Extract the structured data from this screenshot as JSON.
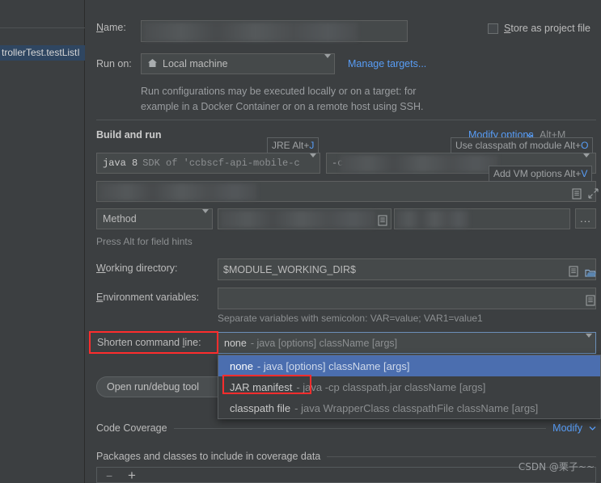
{
  "window": {
    "background": "#3c3f41",
    "accent_blue": "#589df6",
    "selection_blue": "#4b6eaf",
    "annotation_red": "#ff2d2d"
  },
  "sidebar": {
    "selected_item": "trollerTest.testListI"
  },
  "form": {
    "name_label": "Name:",
    "name_value": "",
    "store_as_project_file_label": "Store as project file",
    "store_as_project_file_checked": false,
    "run_on_label": "Run on:",
    "run_on_value": "Local machine",
    "run_on_icon": "home-icon",
    "manage_targets_link": "Manage targets...",
    "description_line1": "Run configurations may be executed locally or on a target: for",
    "description_line2": "example in a Docker Container or on a remote host using SSH.",
    "build_and_run_title": "Build and run",
    "modify_options_link": "Modify options",
    "modify_options_shortcut": "Alt+M",
    "jdk_value": "java 8",
    "jdk_suffix": "SDK of 'ccbscf-api-mobile-c",
    "vm_options_value": "-c",
    "method_label": "Method",
    "press_alt_hint": "Press Alt for field hints",
    "working_directory_label": "Working directory:",
    "working_directory_value": "$MODULE_WORKING_DIR$",
    "environment_variables_label": "Environment variables:",
    "environment_variables_value": "",
    "environment_hint": "Separate variables with semicolon: VAR=value; VAR1=value1",
    "shorten_command_line_label": "Shorten command line:",
    "shorten_command_line_value_strong": "none",
    "shorten_command_line_value_dim": "- java [options] className [args]",
    "open_run_debug_button": "Open run/debug tool",
    "code_coverage_title": "Code Coverage",
    "code_coverage_modify_link": "Modify",
    "packages_classes_title": "Packages and classes to include in coverage data"
  },
  "tooltips": [
    {
      "name": "jre-hint",
      "text": "JRE Alt+J",
      "mnemonic": "J"
    },
    {
      "name": "classpath-module-hint",
      "text": "Use classpath of module Alt+O",
      "mnemonic": "O"
    },
    {
      "name": "vm-options-hint",
      "text": "Add VM options Alt+V",
      "mnemonic": "V"
    }
  ],
  "dropdown": {
    "open": true,
    "options": [
      {
        "strong": "none",
        "dim": "- java [options] className [args]",
        "selected": true
      },
      {
        "strong": "JAR manifest",
        "dim": "- java -cp classpath.jar className [args]",
        "selected": false
      },
      {
        "strong": "classpath file",
        "dim": "- java WrapperClass classpathFile className [args]",
        "selected": false
      }
    ]
  },
  "annotations": [
    {
      "name": "shorten-command-line-label-highlight"
    },
    {
      "name": "jar-manifest-option-highlight"
    }
  ],
  "footer": {
    "remove_button": "−",
    "add_button": "+",
    "watermark": "CSDN @栗子~~"
  }
}
